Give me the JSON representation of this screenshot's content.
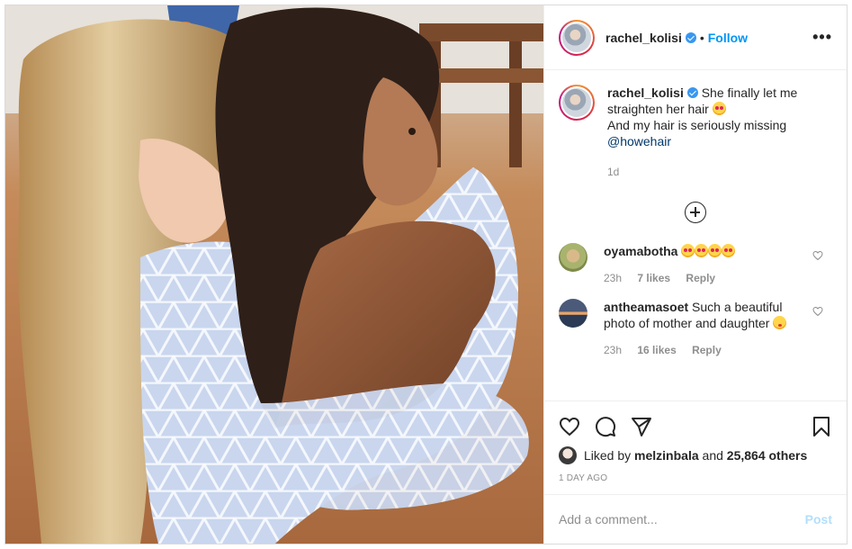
{
  "post": {
    "username": "rachel_kolisi",
    "follow_label": "Follow",
    "dot": "•",
    "more_label": "•••"
  },
  "caption": {
    "username": "rachel_kolisi",
    "text_line1": "She finally let me straighten her hair",
    "text_line2": "And my hair is seriously missing",
    "mention": "@howehair",
    "age": "1d"
  },
  "comments": [
    {
      "username": "oyamabotha",
      "text": "",
      "emoji_count": 4,
      "time": "23h",
      "likes": "7 likes",
      "reply": "Reply"
    },
    {
      "username": "antheamasoet",
      "text": "Such a beautiful photo of mother and daughter",
      "time": "23h",
      "likes": "16 likes",
      "reply": "Reply"
    }
  ],
  "likes": {
    "prefix": "Liked by",
    "user": "melzinbala",
    "joiner": "and",
    "others": "25,864 others"
  },
  "posted_time": "1 DAY AGO",
  "composer": {
    "placeholder": "Add a comment...",
    "post_label": "Post"
  },
  "colors": {
    "link": "#0095f6",
    "verified": "#3897f0",
    "post_disabled": "#b2dffc",
    "muted": "#8e8e8e"
  }
}
